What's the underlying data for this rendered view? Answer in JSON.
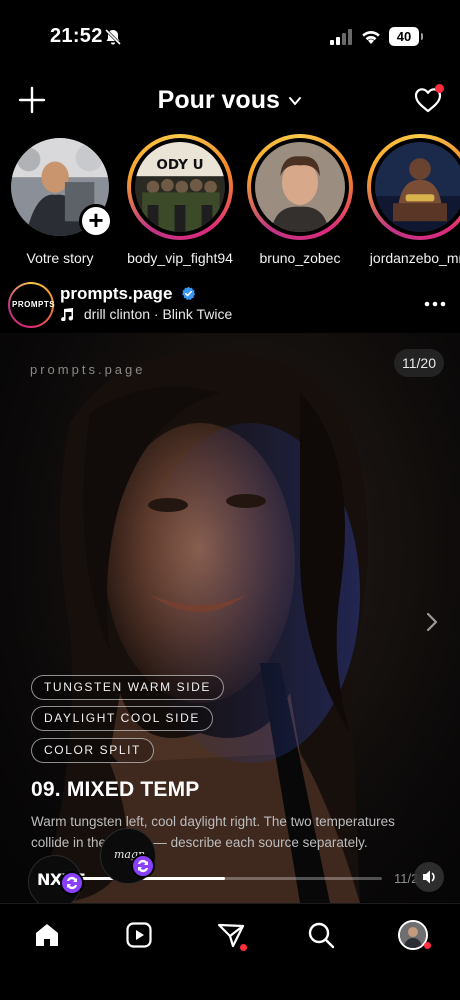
{
  "status_bar": {
    "time": "21:52",
    "battery": "40"
  },
  "header": {
    "title": "Pour vous",
    "notification_dot_color": "#ff2d3d"
  },
  "stories": [
    {
      "label": "Votre story",
      "own": true,
      "ring": false
    },
    {
      "label": "body_vip_fight94",
      "own": false,
      "ring": true
    },
    {
      "label": "bruno_zobec",
      "own": false,
      "ring": true
    },
    {
      "label": "jordanzebo_mm",
      "own": false,
      "ring": true
    }
  ],
  "story_thumb_text": "ODY U",
  "post": {
    "username": "prompts.page",
    "avatar_text": "PROMPTS",
    "audio": "drill clinton · Blink Twice",
    "brand_watermark": "prompts.page",
    "slide_counter": "11/20",
    "tags": [
      "TUNGSTEN WARM SIDE",
      "DAYLIGHT COOL SIDE",
      "COLOR SPLIT"
    ],
    "headline": "09. MIXED TEMP",
    "description": "Warm tungsten left, cool daylight right. The two temperatures collide in the middle — describe each source separately.",
    "progress_text": "11/2",
    "progress_fraction": 0.55,
    "bubbles": [
      {
        "text": "NXXT"
      },
      {
        "text": "magn"
      }
    ]
  },
  "colors": {
    "accent_purple": "#8a3ffc",
    "verified_blue": "#3897f0"
  },
  "nav": {
    "icons": [
      "home-icon",
      "reels-icon",
      "messages-icon",
      "search-icon",
      "profile-icon"
    ]
  }
}
